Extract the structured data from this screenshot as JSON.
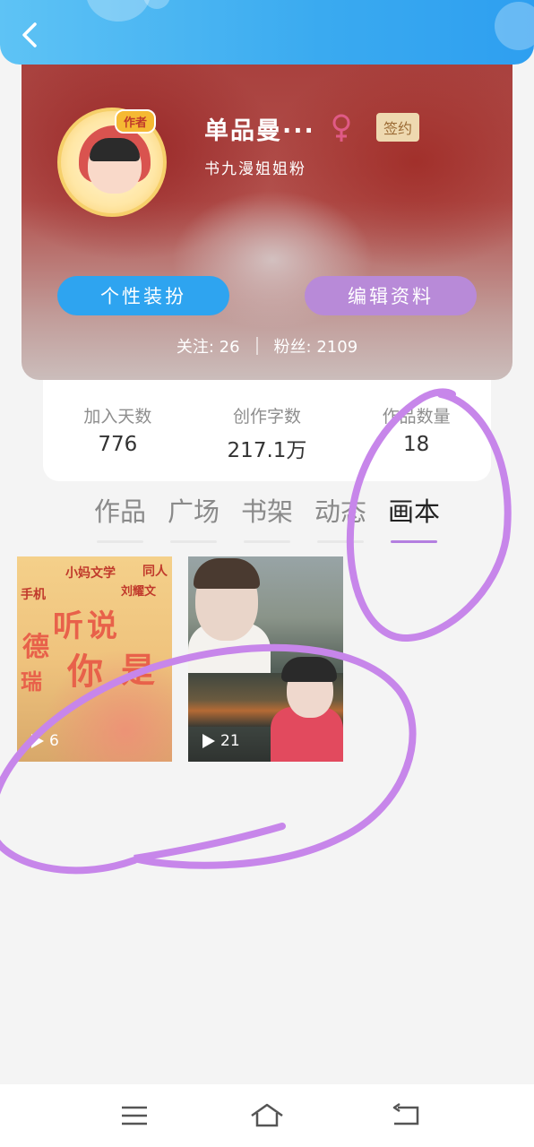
{
  "header": {
    "back_icon": "chevron-left-icon",
    "accent_color": "#3aaaf0"
  },
  "profile": {
    "avatar_badge": "作者",
    "username": "单品曼···",
    "gender_icon": "female-symbol-icon",
    "gender_color": "#e05a86",
    "sign_badge": "签约",
    "subtitle": "书九漫姐姐粉",
    "dress_button": "个性装扮",
    "edit_button": "编辑资料",
    "following_label": "关注: 26",
    "followers_label": "粉丝: 2109"
  },
  "stats": [
    {
      "label": "加入天数",
      "value": "776"
    },
    {
      "label": "创作字数",
      "value": "217.1万"
    },
    {
      "label": "作品数量",
      "value": "18"
    }
  ],
  "tabs": [
    {
      "label": "作品",
      "active": false
    },
    {
      "label": "广场",
      "active": false
    },
    {
      "label": "书架",
      "active": false
    },
    {
      "label": "动态",
      "active": false
    },
    {
      "label": "画本",
      "active": true
    }
  ],
  "thumbnails": [
    {
      "count": "6",
      "texts": [
        "小妈文学",
        "同人",
        "手机",
        "刘耀文",
        "德",
        "听说",
        "你",
        "是",
        "瑞"
      ]
    },
    {
      "count": "21"
    }
  ],
  "bottom_nav": {
    "menu_icon": "menu-icon",
    "home_icon": "home-icon",
    "back_icon": "return-icon"
  },
  "annotation_color": "#c786ea"
}
